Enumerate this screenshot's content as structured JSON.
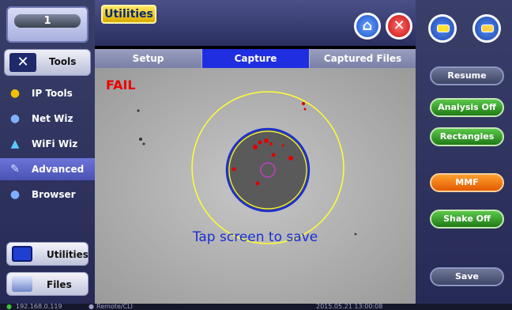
{
  "counter": {
    "value": "1"
  },
  "left_nav": {
    "tools_label": "Tools",
    "items": [
      {
        "label": "IP Tools",
        "icon": "ip-tools-icon"
      },
      {
        "label": "Net Wiz",
        "icon": "net-wiz-icon"
      },
      {
        "label": "WiFi Wiz",
        "icon": "wifi-wiz-icon"
      },
      {
        "label": "Advanced",
        "icon": "advanced-icon"
      },
      {
        "label": "Browser",
        "icon": "browser-icon"
      }
    ],
    "utilities_label": "Utilities",
    "files_label": "Files"
  },
  "header": {
    "title": "Utilities"
  },
  "tabs": [
    {
      "label": "Setup"
    },
    {
      "label": "Capture"
    },
    {
      "label": "Captured Files"
    }
  ],
  "capture": {
    "result": "FAIL",
    "prompt": "Tap screen to save"
  },
  "right_panel": {
    "buttons": [
      {
        "label": "Resume"
      },
      {
        "label": "Analysis Off"
      },
      {
        "label": "Rectangles"
      },
      {
        "label": "MMF"
      },
      {
        "label": "Shake Off"
      },
      {
        "label": "Save"
      }
    ]
  },
  "status_bar": {
    "ip": "192.168.0.119",
    "remote": "Remote/CLI",
    "datetime": "2015.05.21  13:00:08"
  },
  "colors": {
    "fail": "#e00000",
    "active_tab": "#1f2ee0",
    "yellow_ring": "#ffff33",
    "blue_ring": "#1a2fd0",
    "defect": "#e00000",
    "center_mark": "#c040c0"
  }
}
